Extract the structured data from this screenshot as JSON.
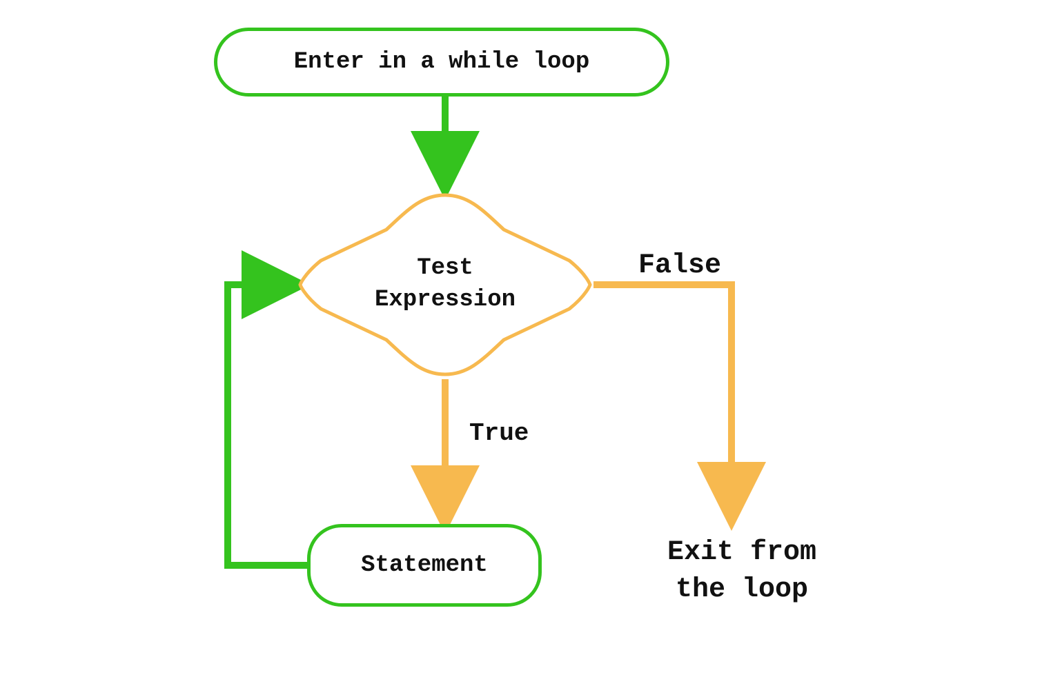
{
  "nodes": {
    "start": {
      "label": "Enter in a while loop",
      "type": "terminal"
    },
    "decision": {
      "line1": "Test",
      "line2": "Expression",
      "type": "decision"
    },
    "statement": {
      "label": "Statement",
      "type": "terminal"
    },
    "exit": {
      "line1": "Exit from",
      "line2": "the loop",
      "type": "text"
    }
  },
  "edges": {
    "true": {
      "label": "True",
      "from": "decision",
      "to": "statement"
    },
    "false": {
      "label": "False",
      "from": "decision",
      "to": "exit"
    },
    "loopback": {
      "from": "statement",
      "to": "decision"
    },
    "enter": {
      "from": "start",
      "to": "decision"
    }
  },
  "colors": {
    "green": "#34c31e",
    "orange": "#f7b94f",
    "text": "#111111"
  }
}
